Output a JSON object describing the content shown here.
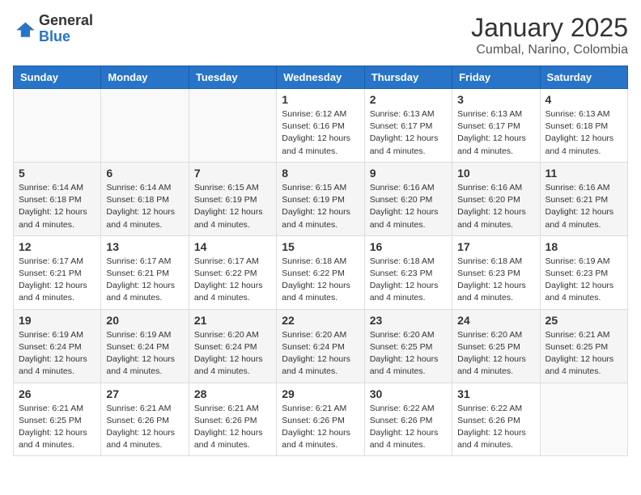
{
  "header": {
    "logo_general": "General",
    "logo_blue": "Blue",
    "title": "January 2025",
    "location": "Cumbal, Narino, Colombia"
  },
  "weekdays": [
    "Sunday",
    "Monday",
    "Tuesday",
    "Wednesday",
    "Thursday",
    "Friday",
    "Saturday"
  ],
  "weeks": [
    [
      {
        "day": "",
        "sunrise": "",
        "sunset": "",
        "daylight": ""
      },
      {
        "day": "",
        "sunrise": "",
        "sunset": "",
        "daylight": ""
      },
      {
        "day": "",
        "sunrise": "",
        "sunset": "",
        "daylight": ""
      },
      {
        "day": "1",
        "sunrise": "Sunrise: 6:12 AM",
        "sunset": "Sunset: 6:16 PM",
        "daylight": "Daylight: 12 hours and 4 minutes."
      },
      {
        "day": "2",
        "sunrise": "Sunrise: 6:13 AM",
        "sunset": "Sunset: 6:17 PM",
        "daylight": "Daylight: 12 hours and 4 minutes."
      },
      {
        "day": "3",
        "sunrise": "Sunrise: 6:13 AM",
        "sunset": "Sunset: 6:17 PM",
        "daylight": "Daylight: 12 hours and 4 minutes."
      },
      {
        "day": "4",
        "sunrise": "Sunrise: 6:13 AM",
        "sunset": "Sunset: 6:18 PM",
        "daylight": "Daylight: 12 hours and 4 minutes."
      }
    ],
    [
      {
        "day": "5",
        "sunrise": "Sunrise: 6:14 AM",
        "sunset": "Sunset: 6:18 PM",
        "daylight": "Daylight: 12 hours and 4 minutes."
      },
      {
        "day": "6",
        "sunrise": "Sunrise: 6:14 AM",
        "sunset": "Sunset: 6:18 PM",
        "daylight": "Daylight: 12 hours and 4 minutes."
      },
      {
        "day": "7",
        "sunrise": "Sunrise: 6:15 AM",
        "sunset": "Sunset: 6:19 PM",
        "daylight": "Daylight: 12 hours and 4 minutes."
      },
      {
        "day": "8",
        "sunrise": "Sunrise: 6:15 AM",
        "sunset": "Sunset: 6:19 PM",
        "daylight": "Daylight: 12 hours and 4 minutes."
      },
      {
        "day": "9",
        "sunrise": "Sunrise: 6:16 AM",
        "sunset": "Sunset: 6:20 PM",
        "daylight": "Daylight: 12 hours and 4 minutes."
      },
      {
        "day": "10",
        "sunrise": "Sunrise: 6:16 AM",
        "sunset": "Sunset: 6:20 PM",
        "daylight": "Daylight: 12 hours and 4 minutes."
      },
      {
        "day": "11",
        "sunrise": "Sunrise: 6:16 AM",
        "sunset": "Sunset: 6:21 PM",
        "daylight": "Daylight: 12 hours and 4 minutes."
      }
    ],
    [
      {
        "day": "12",
        "sunrise": "Sunrise: 6:17 AM",
        "sunset": "Sunset: 6:21 PM",
        "daylight": "Daylight: 12 hours and 4 minutes."
      },
      {
        "day": "13",
        "sunrise": "Sunrise: 6:17 AM",
        "sunset": "Sunset: 6:21 PM",
        "daylight": "Daylight: 12 hours and 4 minutes."
      },
      {
        "day": "14",
        "sunrise": "Sunrise: 6:17 AM",
        "sunset": "Sunset: 6:22 PM",
        "daylight": "Daylight: 12 hours and 4 minutes."
      },
      {
        "day": "15",
        "sunrise": "Sunrise: 6:18 AM",
        "sunset": "Sunset: 6:22 PM",
        "daylight": "Daylight: 12 hours and 4 minutes."
      },
      {
        "day": "16",
        "sunrise": "Sunrise: 6:18 AM",
        "sunset": "Sunset: 6:23 PM",
        "daylight": "Daylight: 12 hours and 4 minutes."
      },
      {
        "day": "17",
        "sunrise": "Sunrise: 6:18 AM",
        "sunset": "Sunset: 6:23 PM",
        "daylight": "Daylight: 12 hours and 4 minutes."
      },
      {
        "day": "18",
        "sunrise": "Sunrise: 6:19 AM",
        "sunset": "Sunset: 6:23 PM",
        "daylight": "Daylight: 12 hours and 4 minutes."
      }
    ],
    [
      {
        "day": "19",
        "sunrise": "Sunrise: 6:19 AM",
        "sunset": "Sunset: 6:24 PM",
        "daylight": "Daylight: 12 hours and 4 minutes."
      },
      {
        "day": "20",
        "sunrise": "Sunrise: 6:19 AM",
        "sunset": "Sunset: 6:24 PM",
        "daylight": "Daylight: 12 hours and 4 minutes."
      },
      {
        "day": "21",
        "sunrise": "Sunrise: 6:20 AM",
        "sunset": "Sunset: 6:24 PM",
        "daylight": "Daylight: 12 hours and 4 minutes."
      },
      {
        "day": "22",
        "sunrise": "Sunrise: 6:20 AM",
        "sunset": "Sunset: 6:24 PM",
        "daylight": "Daylight: 12 hours and 4 minutes."
      },
      {
        "day": "23",
        "sunrise": "Sunrise: 6:20 AM",
        "sunset": "Sunset: 6:25 PM",
        "daylight": "Daylight: 12 hours and 4 minutes."
      },
      {
        "day": "24",
        "sunrise": "Sunrise: 6:20 AM",
        "sunset": "Sunset: 6:25 PM",
        "daylight": "Daylight: 12 hours and 4 minutes."
      },
      {
        "day": "25",
        "sunrise": "Sunrise: 6:21 AM",
        "sunset": "Sunset: 6:25 PM",
        "daylight": "Daylight: 12 hours and 4 minutes."
      }
    ],
    [
      {
        "day": "26",
        "sunrise": "Sunrise: 6:21 AM",
        "sunset": "Sunset: 6:25 PM",
        "daylight": "Daylight: 12 hours and 4 minutes."
      },
      {
        "day": "27",
        "sunrise": "Sunrise: 6:21 AM",
        "sunset": "Sunset: 6:26 PM",
        "daylight": "Daylight: 12 hours and 4 minutes."
      },
      {
        "day": "28",
        "sunrise": "Sunrise: 6:21 AM",
        "sunset": "Sunset: 6:26 PM",
        "daylight": "Daylight: 12 hours and 4 minutes."
      },
      {
        "day": "29",
        "sunrise": "Sunrise: 6:21 AM",
        "sunset": "Sunset: 6:26 PM",
        "daylight": "Daylight: 12 hours and 4 minutes."
      },
      {
        "day": "30",
        "sunrise": "Sunrise: 6:22 AM",
        "sunset": "Sunset: 6:26 PM",
        "daylight": "Daylight: 12 hours and 4 minutes."
      },
      {
        "day": "31",
        "sunrise": "Sunrise: 6:22 AM",
        "sunset": "Sunset: 6:26 PM",
        "daylight": "Daylight: 12 hours and 4 minutes."
      },
      {
        "day": "",
        "sunrise": "",
        "sunset": "",
        "daylight": ""
      }
    ]
  ]
}
